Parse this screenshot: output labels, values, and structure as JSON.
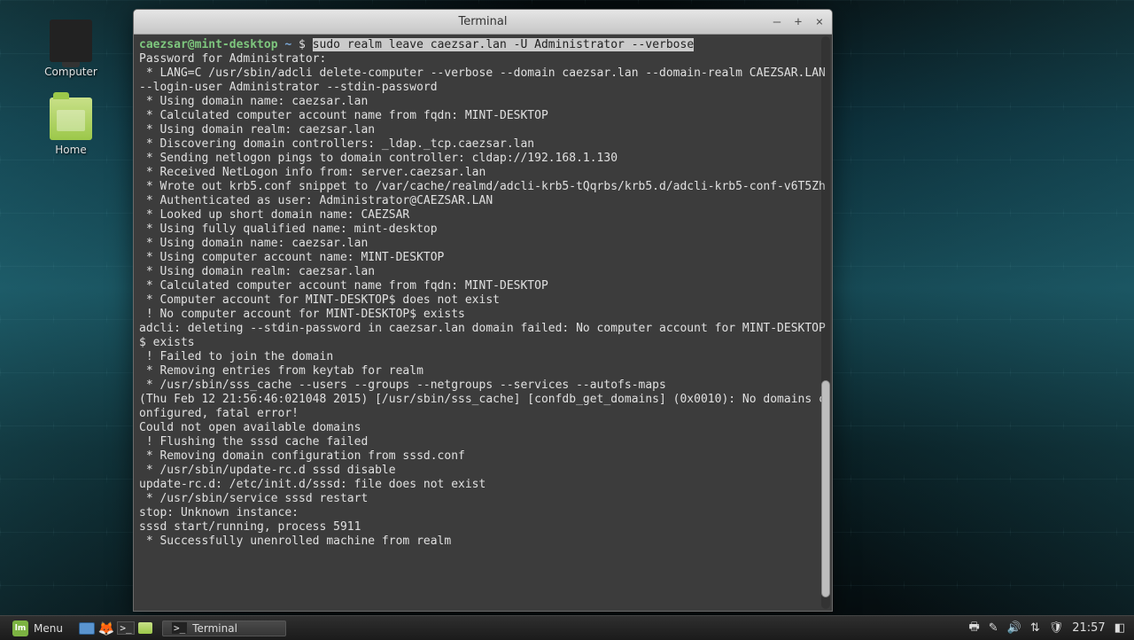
{
  "desktop": {
    "icons": [
      {
        "name": "computer-icon",
        "label": "Computer"
      },
      {
        "name": "home-icon",
        "label": "Home"
      }
    ]
  },
  "terminal": {
    "title": "Terminal",
    "prompt": {
      "userhost": "caezsar@mint-desktop",
      "path": "~",
      "symbol": "$"
    },
    "command": "sudo realm leave caezsar.lan -U Administrator --verbose",
    "output": [
      "Password for Administrator:",
      " * LANG=C /usr/sbin/adcli delete-computer --verbose --domain caezsar.lan --domain-realm CAEZSAR.LAN --login-user Administrator --stdin-password",
      " * Using domain name: caezsar.lan",
      " * Calculated computer account name from fqdn: MINT-DESKTOP",
      " * Using domain realm: caezsar.lan",
      " * Discovering domain controllers: _ldap._tcp.caezsar.lan",
      " * Sending netlogon pings to domain controller: cldap://192.168.1.130",
      " * Received NetLogon info from: server.caezsar.lan",
      " * Wrote out krb5.conf snippet to /var/cache/realmd/adcli-krb5-tQqrbs/krb5.d/adcli-krb5-conf-v6T5Zh",
      " * Authenticated as user: Administrator@CAEZSAR.LAN",
      " * Looked up short domain name: CAEZSAR",
      " * Using fully qualified name: mint-desktop",
      " * Using domain name: caezsar.lan",
      " * Using computer account name: MINT-DESKTOP",
      " * Using domain realm: caezsar.lan",
      " * Calculated computer account name from fqdn: MINT-DESKTOP",
      " * Computer account for MINT-DESKTOP$ does not exist",
      " ! No computer account for MINT-DESKTOP$ exists",
      "adcli: deleting --stdin-password in caezsar.lan domain failed: No computer account for MINT-DESKTOP$ exists",
      " ! Failed to join the domain",
      " * Removing entries from keytab for realm",
      " * /usr/sbin/sss_cache --users --groups --netgroups --services --autofs-maps",
      "(Thu Feb 12 21:56:46:021048 2015) [/usr/sbin/sss_cache] [confdb_get_domains] (0x0010): No domains configured, fatal error!",
      "Could not open available domains",
      " ! Flushing the sssd cache failed",
      " * Removing domain configuration from sssd.conf",
      " * /usr/sbin/update-rc.d sssd disable",
      "update-rc.d: /etc/init.d/sssd: file does not exist",
      " * /usr/sbin/service sssd restart",
      "stop: Unknown instance:",
      "sssd start/running, process 5911",
      " * Successfully unenrolled machine from realm"
    ]
  },
  "taskbar": {
    "menu_label": "Menu",
    "task_label": "Terminal",
    "clock": "21:57"
  }
}
